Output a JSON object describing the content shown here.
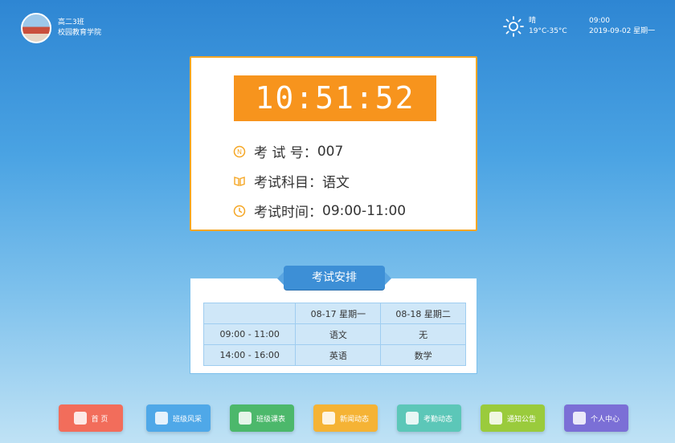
{
  "header": {
    "class_name": "高二3班",
    "school_name": "校园教育学院",
    "weather": {
      "condition": "晴",
      "temperature": "19°C-35°C",
      "icon": "sun-icon"
    },
    "time": "09:00",
    "date": "2019-09-02 星期一"
  },
  "exam": {
    "clock": "10:51:52",
    "number_label": "考 试 号：",
    "number_value": "007",
    "subject_label": "考试科目：",
    "subject_value": "语文",
    "time_label": "考试时间：",
    "time_value": "09:00-11:00"
  },
  "schedule": {
    "title": "考试安排",
    "headers": [
      "",
      "08-17 星期一",
      "08-18 星期二"
    ],
    "rows": [
      [
        "09:00 - 11:00",
        "语文",
        "无"
      ],
      [
        "14:00 - 16:00",
        "英语",
        "数学"
      ]
    ]
  },
  "dock": [
    {
      "label": "首 页",
      "color": "#f26d5b",
      "icon": "home-icon"
    },
    {
      "label": "班级风采",
      "color": "#4fa8e8",
      "icon": "photo-icon"
    },
    {
      "label": "班级课表",
      "color": "#4cb86b",
      "icon": "timetable-icon"
    },
    {
      "label": "新闻动态",
      "color": "#f5b335",
      "icon": "news-icon"
    },
    {
      "label": "考勤动态",
      "color": "#5cc7b8",
      "icon": "attendance-icon"
    },
    {
      "label": "通知公告",
      "color": "#9acb3c",
      "icon": "notice-icon"
    },
    {
      "label": "个人中心",
      "color": "#7b6fd6",
      "icon": "user-icon"
    }
  ]
}
